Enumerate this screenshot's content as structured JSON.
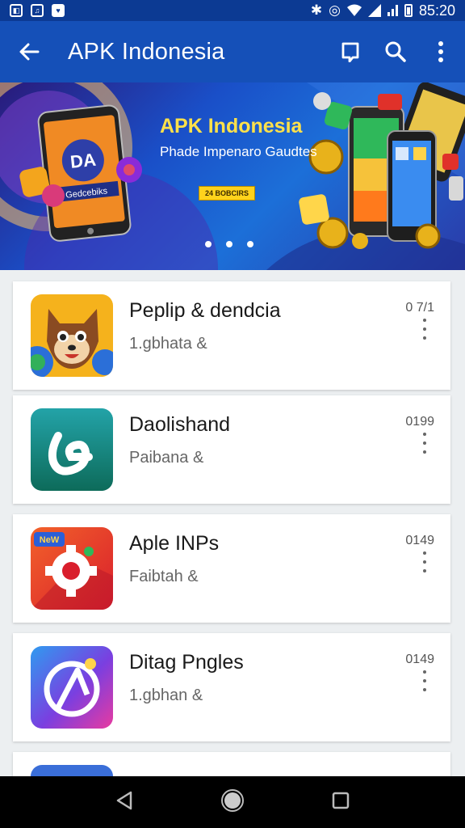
{
  "status_bar": {
    "time": "85:20",
    "left_icons": [
      "notification-icon",
      "notification-icon",
      "notification-icon"
    ],
    "right_icons": [
      "bluetooth-icon",
      "alarm-icon",
      "wifi-icon",
      "signal-icon",
      "battery-icon"
    ]
  },
  "app_bar": {
    "title": "APK Indonesia",
    "back_icon": "arrow-left-icon",
    "actions": [
      "bookmark-icon",
      "search-icon",
      "more-vert-icon"
    ]
  },
  "banner": {
    "title": "APK Indonesia",
    "subtitle": "Phade Impenaro Gaudtes",
    "badge": "24 BOBCIRS",
    "phone_text": "Gedcebiks",
    "phone_logo": "DA",
    "dots": 3
  },
  "apps": [
    {
      "name": "Peplip & dendcia",
      "subtitle": "1.gbhata &",
      "count": "0 7/1",
      "icon": "cat-app-icon"
    },
    {
      "name": "Daolishand",
      "subtitle": "Paibana &",
      "count": "0199",
      "icon": "loop-app-icon"
    },
    {
      "name": "Aple INPs",
      "subtitle": "Faibtah &",
      "count": "0149",
      "icon": "gear-app-icon"
    },
    {
      "name": "Ditag Pngles",
      "subtitle": "1.gbhan &",
      "count": "0149",
      "icon": "compass-app-icon"
    },
    {
      "name": "",
      "subtitle": "",
      "count": "",
      "icon": "partial-app-icon"
    }
  ],
  "nav_bar": {
    "buttons": [
      "back-triangle-icon",
      "home-circle-icon",
      "recents-square-icon"
    ]
  },
  "colors": {
    "status_bar": "#0c3a93",
    "app_bar": "#1550b8",
    "banner_title": "#ffe14a",
    "page_background": "#eceff1"
  }
}
